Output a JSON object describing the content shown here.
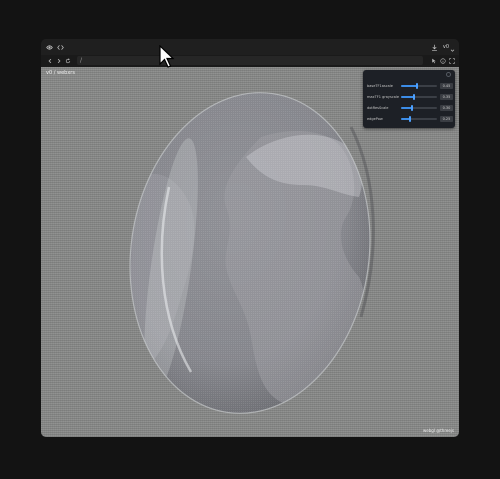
{
  "toolbar": {
    "left_icons": [
      "eye-icon",
      "code-icon"
    ],
    "download_icon": "download-icon",
    "version_label": "v0",
    "version_dropdown_icon": "chevron-down-icon"
  },
  "nav": {
    "back_icon": "chevron-left-icon",
    "forward_icon": "chevron-right-icon",
    "refresh_icon": "refresh-icon",
    "url": "/",
    "right_icons": [
      "pointer-icon",
      "info-icon",
      "fullscreen-icon"
    ]
  },
  "viewport": {
    "title": "v0 / webxrs",
    "credit": "webgl @threejs"
  },
  "panel": {
    "controls": [
      {
        "label": "baseTF1ascale",
        "value": 0.45,
        "display": "0.45"
      },
      {
        "label": "maxTF1 grayscale",
        "value": 0.35,
        "display": "0.35"
      },
      {
        "label": "dotResScale",
        "value": 0.3,
        "display": "0.30"
      },
      {
        "label": "edgePow",
        "value": 0.25,
        "display": "0.25"
      }
    ]
  },
  "colors": {
    "background": "#131313",
    "panel_bg": "#1d2026",
    "accent": "#3c8de8"
  }
}
